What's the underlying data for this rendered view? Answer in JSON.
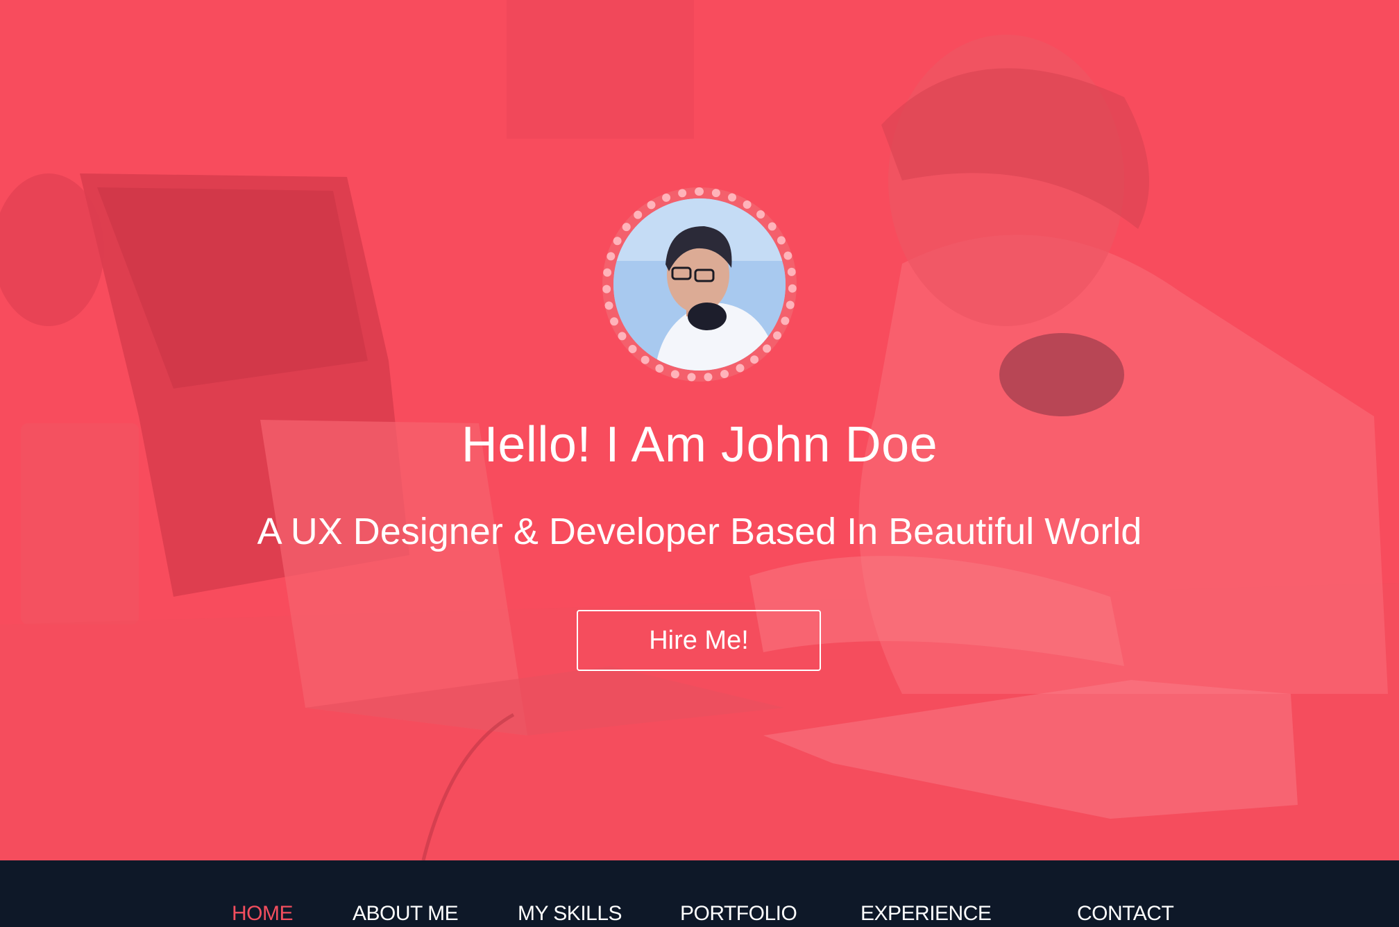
{
  "hero": {
    "greeting": "Hello! I Am John Doe",
    "tagline": "A UX Designer & Developer Based In Beautiful World",
    "cta_label": "Hire Me!",
    "overlay_color": "#f2515f"
  },
  "nav": {
    "items": [
      {
        "label": "HOME",
        "active": true
      },
      {
        "label": "ABOUT ME",
        "active": false
      },
      {
        "label": "MY SKILLS",
        "active": false
      },
      {
        "label": "PORTFOLIO",
        "active": false
      },
      {
        "label": "EXPERIENCE",
        "active": false
      },
      {
        "label": "CONTACT",
        "active": false
      }
    ],
    "active_color": "#f24e5e",
    "background": "#0e1828"
  }
}
